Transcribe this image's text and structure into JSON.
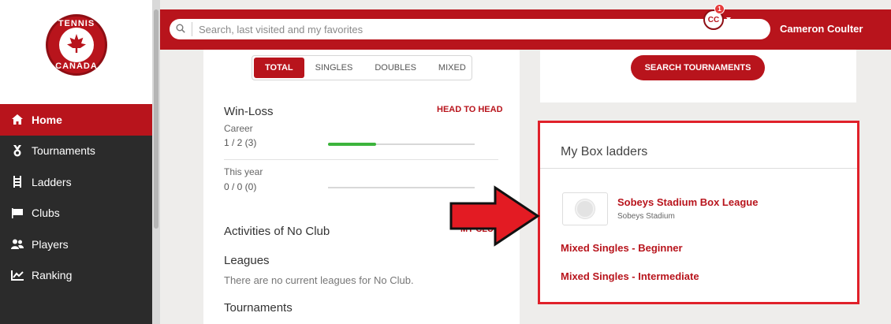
{
  "logo": {
    "text_top": "TENNIS",
    "text_bottom": "CANADA"
  },
  "sidebar": {
    "items": [
      {
        "label": "Home",
        "icon": "home-icon",
        "active": true
      },
      {
        "label": "Tournaments",
        "icon": "medal-icon",
        "active": false
      },
      {
        "label": "Ladders",
        "icon": "ladder-icon",
        "active": false
      },
      {
        "label": "Clubs",
        "icon": "flag-icon",
        "active": false
      },
      {
        "label": "Players",
        "icon": "people-icon",
        "active": false
      },
      {
        "label": "Ranking",
        "icon": "chart-icon",
        "active": false
      }
    ]
  },
  "topbar": {
    "search_placeholder": "Search, last visited and my favorites",
    "user_name": "Cameron Coulter",
    "avatar_initials": "CC",
    "notification_count": "1"
  },
  "stats": {
    "tabs": [
      {
        "label": "TOTAL",
        "active": true
      },
      {
        "label": "SINGLES",
        "active": false
      },
      {
        "label": "DOUBLES",
        "active": false
      },
      {
        "label": "MIXED",
        "active": false
      }
    ],
    "title": "Win-Loss",
    "head_to_head": "HEAD TO HEAD",
    "career_label": "Career",
    "career_value": "1 / 2 (3)",
    "career_win_fraction": 0.33,
    "year_label": "This year",
    "year_value": "0 / 0 (0)",
    "year_win_fraction": 0
  },
  "activities": {
    "title": "Activities of No Club",
    "my_club": "MY CLUB",
    "leagues_title": "Leagues",
    "leagues_empty": "There are no current leagues for No Club.",
    "tournaments_title": "Tournaments"
  },
  "search_tournaments": "SEARCH TOURNAMENTS",
  "box_ladders": {
    "title": "My Box ladders",
    "club_name": "Sobeys Stadium Box League",
    "club_sub": "Sobeys Stadium",
    "links": [
      "Mixed Singles - Beginner",
      "Mixed Singles - Intermediate"
    ]
  },
  "colors": {
    "brand": "#b8141c",
    "highlight": "#e0212a",
    "progress": "#3cb43c"
  }
}
